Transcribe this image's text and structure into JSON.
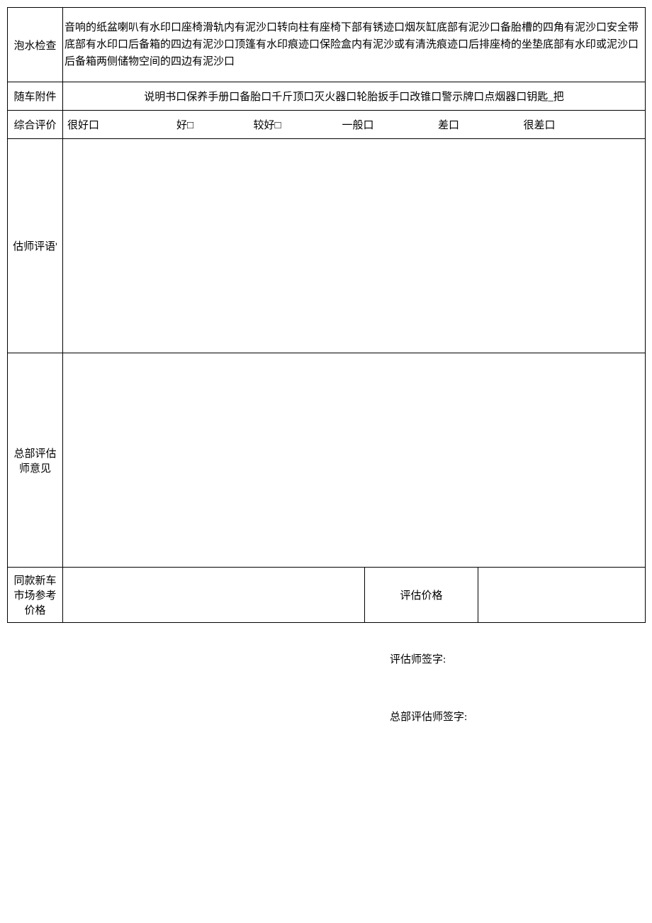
{
  "rows": {
    "water_check_label": "泡水检查",
    "water_check_content": "音响的纸盆喇叭有水印口座椅滑轨内有泥沙口转向柱有座椅下部有锈迹口烟灰缸底部有泥沙口备胎槽的四角有泥沙口安全带底部有水印口后备箱的四边有泥沙口顶篷有水印痕迹口保险盒内有泥沙或有清洗痕迹口后排座椅的坐垫底部有水印或泥沙口后备箱两侧储物空间的四边有泥沙口",
    "accessories_label": "随车附件",
    "accessories_content": "说明书口保养手册口备胎口千斤顶口灭火器口轮胎扳手口改锥口警示牌口点烟器口钥匙_把",
    "overall_eval_label": "综合评价",
    "eval_options": {
      "very_good": "很好口",
      "good": "好□",
      "fairly_good": "较好□",
      "average": "一般口",
      "bad": "差口",
      "very_bad": "很差口"
    },
    "appraiser_comment_label": "估师评语'",
    "hq_appraiser_opinion_label": "总部评估师意见",
    "same_model_price_label": "同款新车市场参考价格",
    "appraisal_price_label": "评估价格"
  },
  "signatures": {
    "appraiser": "评估师签字:",
    "hq_appraiser": "总部评估师签字:"
  }
}
